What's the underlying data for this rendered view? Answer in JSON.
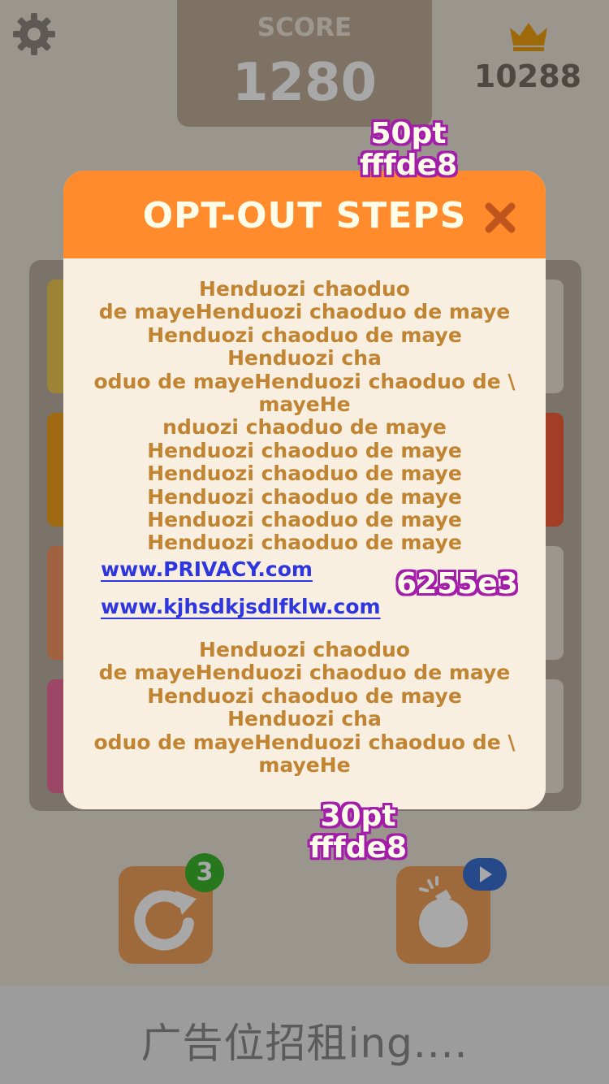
{
  "header": {
    "score_label": "SCORE",
    "score_value": "1280",
    "best_score": "10288"
  },
  "board": {
    "tile_colors": [
      "#edc850",
      "#f2b179",
      "#f59563",
      "#ed6d9c",
      "#f65e3b"
    ]
  },
  "actions": {
    "undo_count": "3"
  },
  "ad": {
    "text": "广告位招租ing...."
  },
  "modal": {
    "title": "OPT-OUT STEPS",
    "header_color": "#ff8b2c",
    "body_text_top": "Henduozi chaoduo\n de mayeHenduozi chaoduo de maye\nHenduozi chaoduo de maye\nHenduozi cha\noduo de mayeHenduozi chaoduo de \\\nmayeHe\nnduozi chaoduo de maye\nHenduozi chaoduo de maye\nHenduozi chaoduo de maye\nHenduozi chaoduo de maye\nHenduozi chaoduo de maye\nHenduozi chaoduo de maye",
    "link_1": "www.PRIVACY.com",
    "link_2": "www.kjhsdkjsdlfklw.com",
    "body_text_bottom": "Henduozi chaoduo\n de mayeHenduozi chaoduo de maye\nHenduozi chaoduo de maye\nHenduozi cha\noduo de mayeHenduozi chaoduo de \\\nmayeHe"
  },
  "annotations": {
    "top": "50pt\nfffde8",
    "mid": "6255e3",
    "bottom": "30pt\nfffde8"
  }
}
